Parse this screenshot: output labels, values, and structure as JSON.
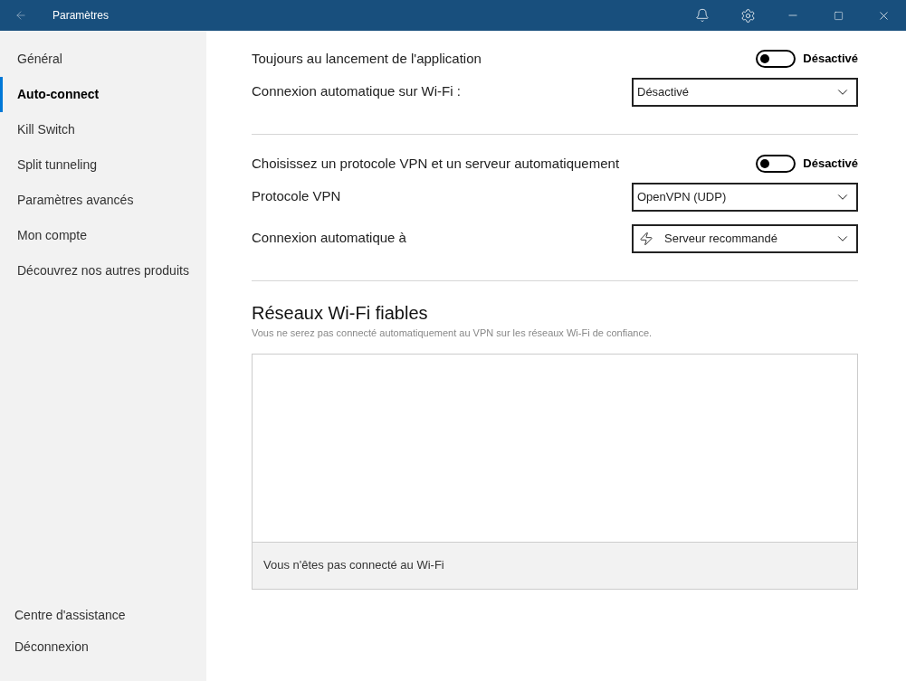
{
  "window": {
    "title": "Paramètres"
  },
  "sidebar": {
    "items": [
      {
        "label": "Général",
        "selected": false
      },
      {
        "label": "Auto-connect",
        "selected": true
      },
      {
        "label": "Kill Switch",
        "selected": false
      },
      {
        "label": "Split tunneling",
        "selected": false
      },
      {
        "label": "Paramètres avancés",
        "selected": false
      },
      {
        "label": "Mon compte",
        "selected": false
      },
      {
        "label": "Découvrez nos autres produits",
        "selected": false
      }
    ],
    "footer_items": [
      "Centre d'assistance",
      "Déconnexion"
    ]
  },
  "sections": [
    {
      "rows": [
        {
          "kind": "toggle",
          "label": "Toujours au lancement de l'application",
          "on": false,
          "state_text": "Désactivé"
        },
        {
          "kind": "select",
          "label": "Connexion automatique sur Wi-Fi :",
          "value": "Désactivé",
          "has_icon": false
        }
      ]
    },
    {
      "rows": [
        {
          "kind": "toggle",
          "label": "Choisissez un protocole VPN et un serveur automatiquement",
          "on": false,
          "state_text": "Désactivé"
        },
        {
          "kind": "select",
          "label": "Protocole VPN",
          "value": "OpenVPN (UDP)",
          "has_icon": false
        },
        {
          "kind": "select",
          "label": "Connexion automatique à",
          "value": "Serveur recommandé",
          "has_icon": true
        }
      ]
    }
  ],
  "trusted_networks": {
    "title": "Réseaux Wi-Fi fiables",
    "description": "Vous ne serez pas connecté automatiquement au VPN sur les réseaux Wi-Fi de confiance.",
    "footer": "Vous n'êtes pas connecté au Wi-Fi"
  }
}
